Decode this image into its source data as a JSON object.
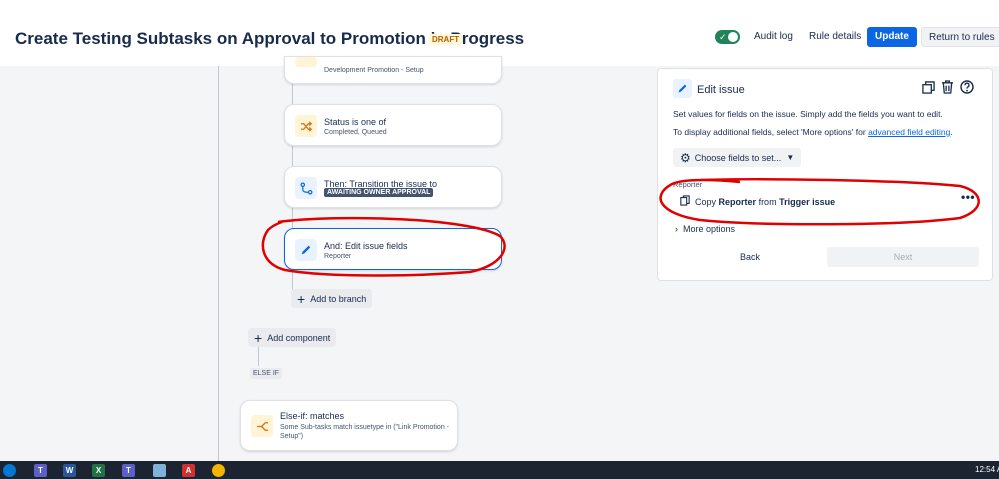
{
  "header": {
    "title": "Create Testing Subtasks on Approval to Promotion in Progress",
    "badge": "DRAFT",
    "audit_log": "Audit log",
    "rule_details": "Rule details",
    "update": "Update",
    "return_to_rules": "Return to rules"
  },
  "flow": {
    "cards": [
      {
        "title": "",
        "subtitle": "Development Promotion - Setup",
        "icon": "condition-icon"
      },
      {
        "title": "Status is one of",
        "subtitle": "Completed, Queued",
        "icon": "shuffle-icon"
      },
      {
        "title": "Then: Transition the issue to",
        "lozenge": "AWAITING OWNER APPROVAL",
        "icon": "transition-icon"
      },
      {
        "title": "And: Edit issue fields",
        "subtitle": "Reporter",
        "icon": "pencil-icon"
      },
      {
        "title": "Else-if: matches",
        "subtitle": "Some Sub-tasks match issuetype in (\"Link Promotion -",
        "subtitle2": "Setup\")",
        "icon": "branch-icon"
      }
    ],
    "add_to_branch": "Add to branch",
    "add_component": "Add component",
    "else_if": "ELSE IF"
  },
  "panel": {
    "title": "Edit issue",
    "desc1": "Set values for fields on the issue. Simply add the fields you want to edit.",
    "desc2_prefix": "To display additional fields, select 'More options' for ",
    "desc2_link": "advanced field editing",
    "desc2_suffix": ".",
    "choose_fields": "Choose fields to set...",
    "field_label": "Reporter",
    "copy_text": "Copy",
    "copy_field": "Reporter",
    "from_text": "from",
    "source": "Trigger issue",
    "more_options": "More options",
    "back": "Back",
    "next": "Next"
  },
  "taskbar": {
    "clock": "12:54 A"
  },
  "colors": {
    "accent": "#0c66e4",
    "toggle_on": "#1f845a",
    "annotation": "#e00000"
  }
}
